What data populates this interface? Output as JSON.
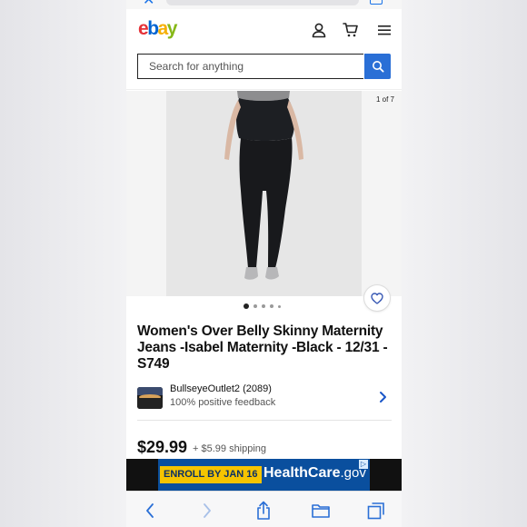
{
  "browser": {
    "close_glyph": "✕"
  },
  "header": {
    "logo_letters": [
      "e",
      "b",
      "a",
      "y"
    ],
    "logo_colors": [
      "#e53238",
      "#0064d2",
      "#f5af02",
      "#86b817"
    ],
    "icons": [
      "user-icon",
      "cart-icon",
      "menu-icon"
    ]
  },
  "search": {
    "placeholder": "Search for anything",
    "value": ""
  },
  "gallery": {
    "counter": "1 of 7",
    "dots_total": 5,
    "active_dot": 0
  },
  "listing": {
    "title": "Women's Over Belly Skinny Maternity Jeans -Isabel Maternity -Black - 12/31 - S749",
    "price": "$29.99",
    "shipping": "+ $5.99 shipping"
  },
  "seller": {
    "name": "BullseyeOutlet2 (2089)",
    "feedback": "100% positive feedback"
  },
  "ad": {
    "enroll_text": "ENROLL BY JAN 16",
    "brand_main": "HealthCare",
    "brand_suffix": ".gov",
    "adchoice": "▷"
  },
  "bottom_bar": {
    "icons": [
      "back-icon",
      "forward-icon",
      "share-icon",
      "bookmarks-icon",
      "tabs-icon"
    ]
  },
  "colors": {
    "accent": "#2a6fd6",
    "link_chevron": "#1a56c8"
  }
}
